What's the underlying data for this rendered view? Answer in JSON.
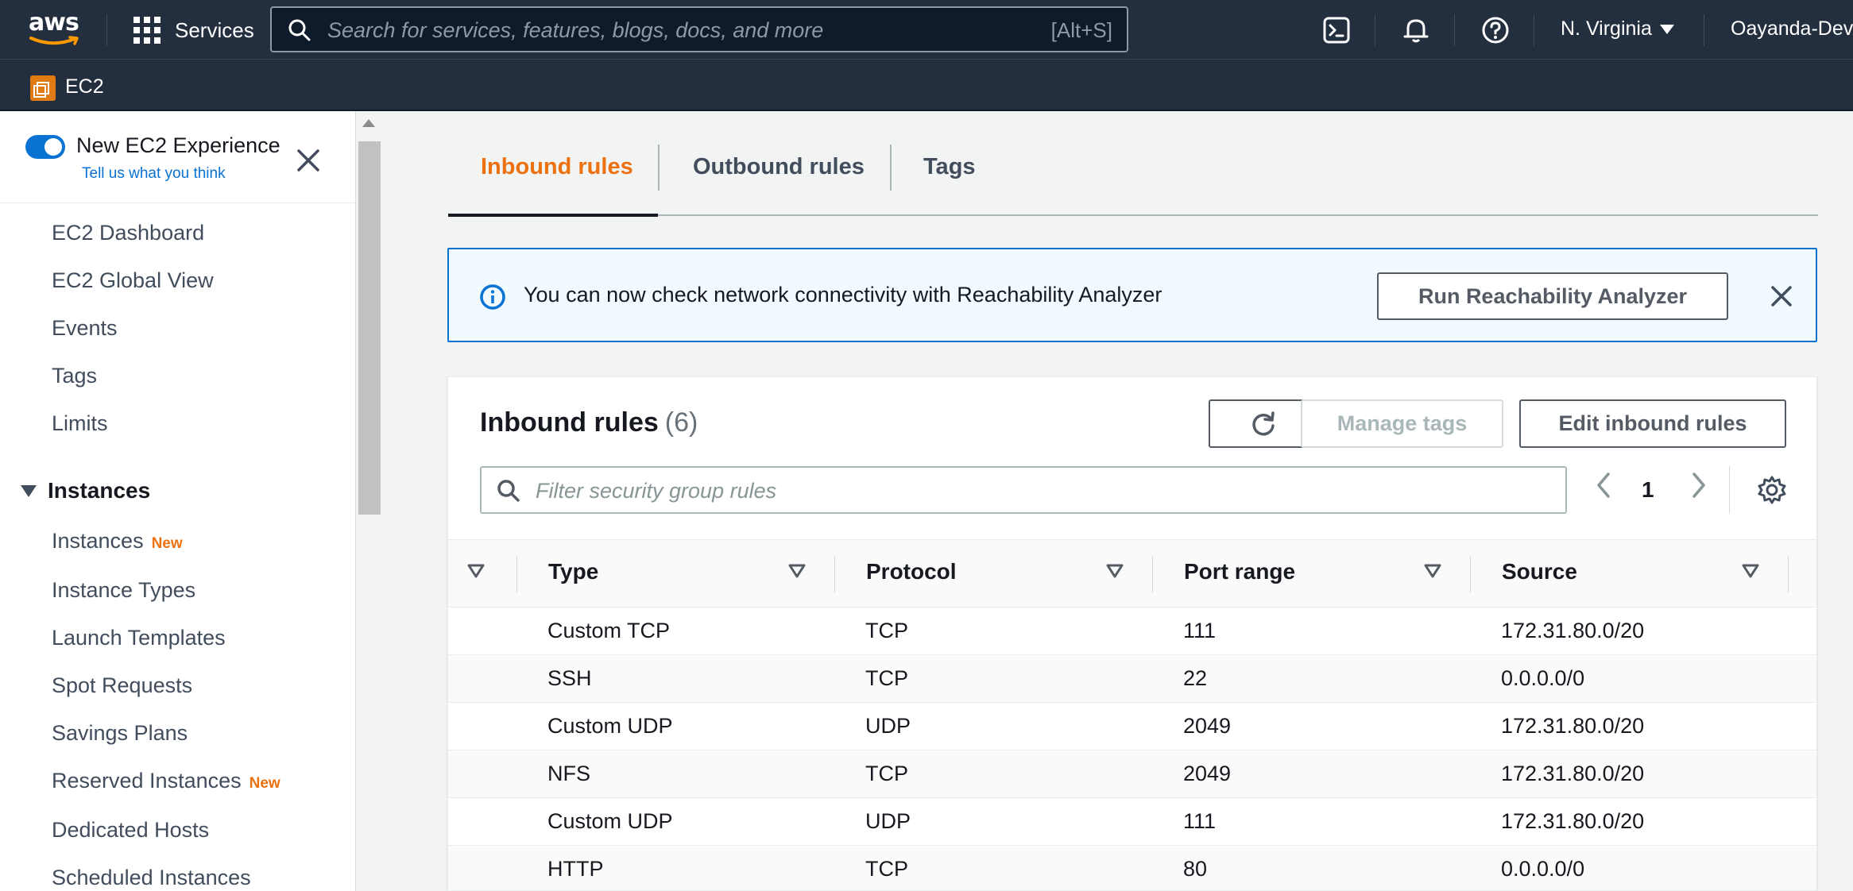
{
  "topnav": {
    "logo_text": "aws",
    "services_label": "Services",
    "search_placeholder": "Search for services, features, blogs, docs, and more",
    "search_shortcut": "[Alt+S]",
    "region": "N. Virginia",
    "account": "Oayanda-Dev"
  },
  "subnav": {
    "service": "EC2"
  },
  "sidebar": {
    "new_experience": "New EC2 Experience",
    "feedback_link": "Tell us what you think",
    "top_items": [
      "EC2 Dashboard",
      "EC2 Global View",
      "Events",
      "Tags",
      "Limits"
    ],
    "section_title": "Instances",
    "section_items": [
      {
        "label": "Instances",
        "badge": "New"
      },
      {
        "label": "Instance Types",
        "badge": ""
      },
      {
        "label": "Launch Templates",
        "badge": ""
      },
      {
        "label": "Spot Requests",
        "badge": ""
      },
      {
        "label": "Savings Plans",
        "badge": ""
      },
      {
        "label": "Reserved Instances",
        "badge": "New"
      },
      {
        "label": "Dedicated Hosts",
        "badge": ""
      },
      {
        "label": "Scheduled Instances",
        "badge": ""
      }
    ]
  },
  "tabs": [
    "Inbound rules",
    "Outbound rules",
    "Tags"
  ],
  "alert": {
    "message": "You can now check network connectivity with Reachability Analyzer",
    "button": "Run Reachability Analyzer"
  },
  "panel": {
    "title": "Inbound rules",
    "count": "(6)",
    "manage_tags": "Manage tags",
    "edit_rules": "Edit inbound rules",
    "filter_placeholder": "Filter security group rules",
    "page": "1",
    "columns": [
      "Type",
      "Protocol",
      "Port range",
      "Source"
    ],
    "rows": [
      [
        "Custom TCP",
        "TCP",
        "111",
        "172.31.80.0/20"
      ],
      [
        "SSH",
        "TCP",
        "22",
        "0.0.0.0/0"
      ],
      [
        "Custom UDP",
        "UDP",
        "2049",
        "172.31.80.0/20"
      ],
      [
        "NFS",
        "TCP",
        "2049",
        "172.31.80.0/20"
      ],
      [
        "Custom UDP",
        "UDP",
        "111",
        "172.31.80.0/20"
      ],
      [
        "HTTP",
        "TCP",
        "80",
        "0.0.0.0/0"
      ]
    ]
  },
  "colors": {
    "nav_bg": "#232f3e",
    "accent": "#ec7211",
    "link": "#0972d3"
  }
}
